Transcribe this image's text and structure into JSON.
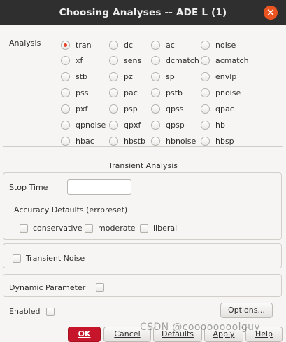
{
  "window": {
    "title": "Choosing Analyses -- ADE L (1)",
    "close_glyph": "✕"
  },
  "analysis": {
    "label": "Analysis",
    "selected": "tran",
    "options": [
      "tran",
      "dc",
      "ac",
      "noise",
      "xf",
      "sens",
      "dcmatch",
      "acmatch",
      "stb",
      "pz",
      "sp",
      "envlp",
      "pss",
      "pac",
      "pstb",
      "pnoise",
      "pxf",
      "psp",
      "qpss",
      "qpac",
      "qpnoise",
      "qpxf",
      "qpsp",
      "hb",
      "hbac",
      "hbstb",
      "hbnoise",
      "hbsp"
    ]
  },
  "transient": {
    "section_title": "Transient Analysis",
    "stop_time_label": "Stop Time",
    "stop_time_value": "",
    "accuracy_label": "Accuracy Defaults (errpreset)",
    "accuracy_options": [
      "conservative",
      "moderate",
      "liberal"
    ],
    "transient_noise_label": "Transient Noise",
    "dynamic_parameter_label": "Dynamic Parameter",
    "enabled_label": "Enabled",
    "options_button": "Options..."
  },
  "buttons": {
    "ok": "OK",
    "cancel": "Cancel",
    "defaults": "Defaults",
    "apply": "Apply",
    "help": "Help"
  },
  "watermark": "CSDN @coooooooolguy",
  "colors": {
    "accent_red": "#c7162b",
    "close_orange": "#e95420",
    "radio_dot": "#e2432a"
  }
}
